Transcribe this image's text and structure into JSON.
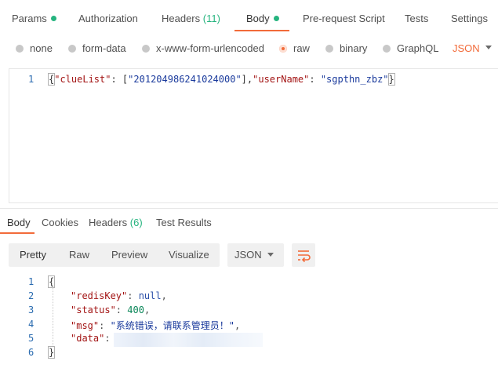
{
  "request_tabs": [
    {
      "label": "Params",
      "badge": ""
    },
    {
      "label": "Authorization",
      "badge": ""
    },
    {
      "label": "Headers",
      "badge": "(11)"
    },
    {
      "label": "Body",
      "badge": ""
    },
    {
      "label": "Pre-request Script",
      "badge": ""
    },
    {
      "label": "Tests",
      "badge": ""
    },
    {
      "label": "Settings",
      "badge": ""
    }
  ],
  "body_types": [
    "none",
    "form-data",
    "x-www-form-urlencoded",
    "raw",
    "binary",
    "GraphQL"
  ],
  "selected_body_type": "raw",
  "format_label": "JSON",
  "request_editor": {
    "line_number": "1",
    "text_open": "{",
    "key1": "\"clueList\"",
    "sep1": ": [",
    "val1": "\"201204986241024000\"",
    "sep2": "],",
    "key2": "\"userName\"",
    "sep3": ": ",
    "val2": "\"sgpthn_zbz\"",
    "text_close": "}"
  },
  "response_tabs": [
    {
      "label": "Body",
      "badge": ""
    },
    {
      "label": "Cookies",
      "badge": ""
    },
    {
      "label": "Headers",
      "badge": "(6)"
    },
    {
      "label": "Test Results",
      "badge": ""
    }
  ],
  "view_modes": [
    "Pretty",
    "Raw",
    "Preview",
    "Visualize"
  ],
  "response_format": "JSON",
  "response_lines": {
    "n1": "1",
    "n2": "2",
    "n3": "3",
    "n4": "4",
    "n5": "5",
    "n6": "6",
    "l1": "{",
    "k2": "\"redisKey\"",
    "v2": "null",
    "k3": "\"status\"",
    "v3": "400",
    "k4": "\"msg\"",
    "v4": "\"系统错误，请联系管理员！\"",
    "k5": "\"data\"",
    "l6": "}"
  },
  "colors": {
    "accent": "#f26b3a",
    "green": "#26b47f"
  }
}
